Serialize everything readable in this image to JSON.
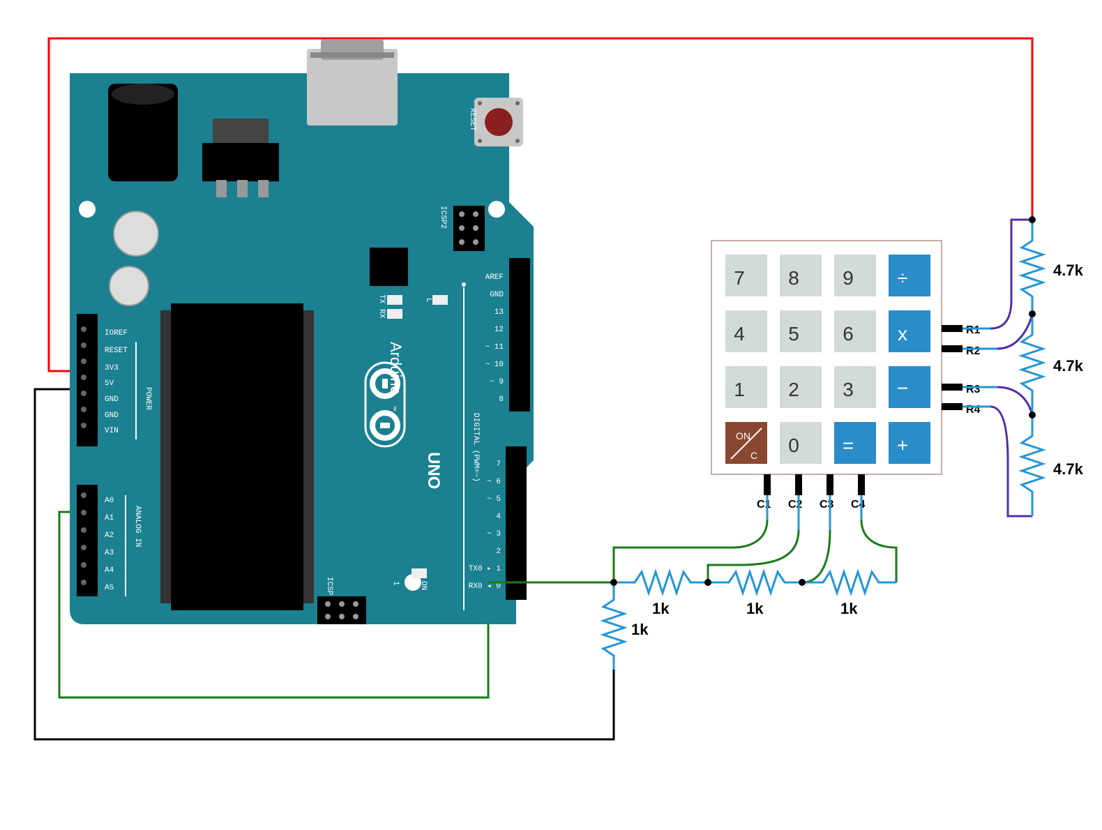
{
  "arduino": {
    "brand": "Arduino",
    "model": "UNO",
    "tm": "™",
    "reset_label": "RESET",
    "left_header_section": "POWER",
    "analog_section": "ANALOG IN",
    "digital_section": "DIGITAL (PWM=~)",
    "icsp2": "ICSP2",
    "icsp": "ICSP",
    "tx": "TX",
    "rx": "RX",
    "on": "ON",
    "l_label": "L",
    "one_label": "1",
    "left_pins": [
      "IOREF",
      "RESET",
      "3V3",
      "5V",
      "GND",
      "GND",
      "VIN"
    ],
    "analog_pins": [
      "A0",
      "A1",
      "A2",
      "A3",
      "A4",
      "A5"
    ],
    "right_pins_top": [
      "AREF",
      "GND",
      "13",
      "12",
      "~ 11",
      "~ 10",
      "~ 9",
      "8"
    ],
    "right_pins_bottom": [
      "7",
      "~ 6",
      "~ 5",
      "4",
      "~ 3",
      "2",
      "TX0 ▸ 1",
      "RX0 ◂ 0"
    ]
  },
  "keypad": {
    "rows": [
      [
        "7",
        "8",
        "9",
        "÷"
      ],
      [
        "4",
        "5",
        "6",
        "x"
      ],
      [
        "1",
        "2",
        "3",
        "−"
      ],
      [
        "ON/C",
        "0",
        "=",
        "+"
      ]
    ],
    "row_pins": [
      "R1",
      "R2",
      "R3",
      "R4"
    ],
    "col_pins": [
      "C1",
      "C2",
      "C3",
      "C4"
    ]
  },
  "resistors": {
    "row_value": "4.7k",
    "col_value": "1k"
  }
}
